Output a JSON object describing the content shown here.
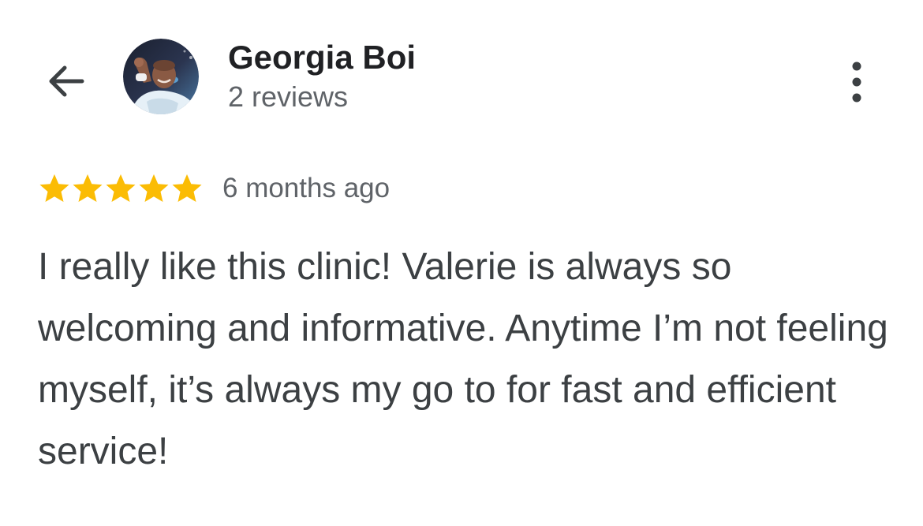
{
  "header": {
    "back_icon": "arrow-left-icon",
    "reviewer_name": "Georgia Boi",
    "review_count": "2 reviews",
    "more_icon": "more-vertical-icon"
  },
  "review": {
    "rating": 5,
    "rating_max": 5,
    "star_color": "#fbbc04",
    "time": "6 months ago",
    "text": "I really like this clinic! Valerie is always so welcoming and informative. Anytime I’m not feeling myself, it’s always my go to for fast and efficient service!"
  }
}
